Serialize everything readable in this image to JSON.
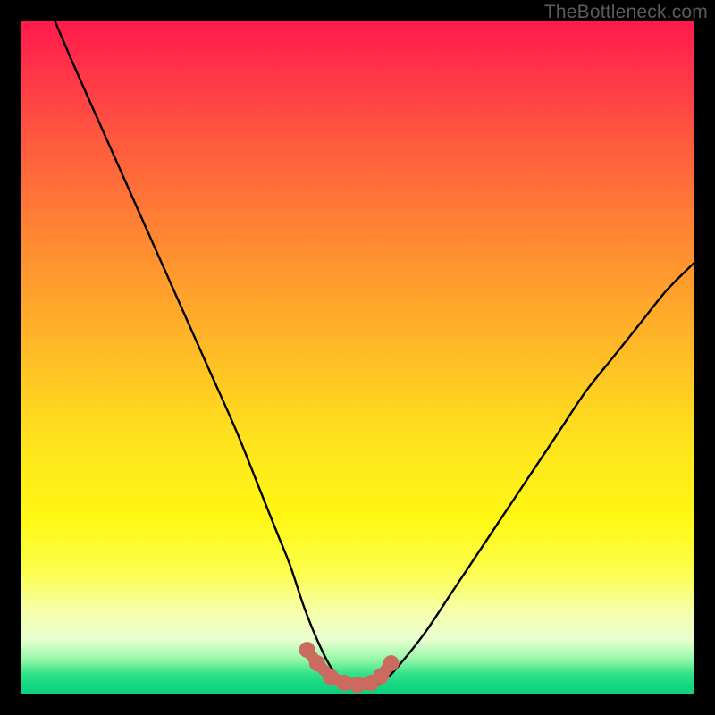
{
  "watermark": {
    "text": "TheBottleneck.com"
  },
  "colors": {
    "background": "#000000",
    "curve": "#000000",
    "marker": "#cc6a60",
    "gradient_top": "#ff1a4b",
    "gradient_mid": "#ffe21e",
    "gradient_bottom": "#0fd07f"
  },
  "chart_data": {
    "type": "line",
    "title": "",
    "xlabel": "",
    "ylabel": "",
    "xlim": [
      0,
      100
    ],
    "ylim": [
      0,
      100
    ],
    "series": [
      {
        "name": "bottleneck-curve",
        "x": [
          5,
          8,
          12,
          16,
          20,
          24,
          28,
          32,
          36,
          38,
          40,
          42,
          44,
          46,
          48,
          50,
          52,
          54,
          56,
          60,
          64,
          68,
          72,
          76,
          80,
          84,
          88,
          92,
          96,
          100
        ],
        "y": [
          100,
          93,
          84,
          75,
          66,
          57,
          48,
          39,
          29,
          24,
          19,
          13,
          8,
          4,
          2,
          1,
          1,
          2,
          4,
          9,
          15,
          21,
          27,
          33,
          39,
          45,
          50,
          55,
          60,
          64
        ]
      }
    ],
    "markers": {
      "name": "valley-markers",
      "x": [
        42.5,
        44,
        46,
        48,
        50,
        52,
        53.5,
        55
      ],
      "y": [
        6.5,
        4.5,
        2.5,
        1.6,
        1.3,
        1.6,
        2.6,
        4.5
      ]
    }
  }
}
